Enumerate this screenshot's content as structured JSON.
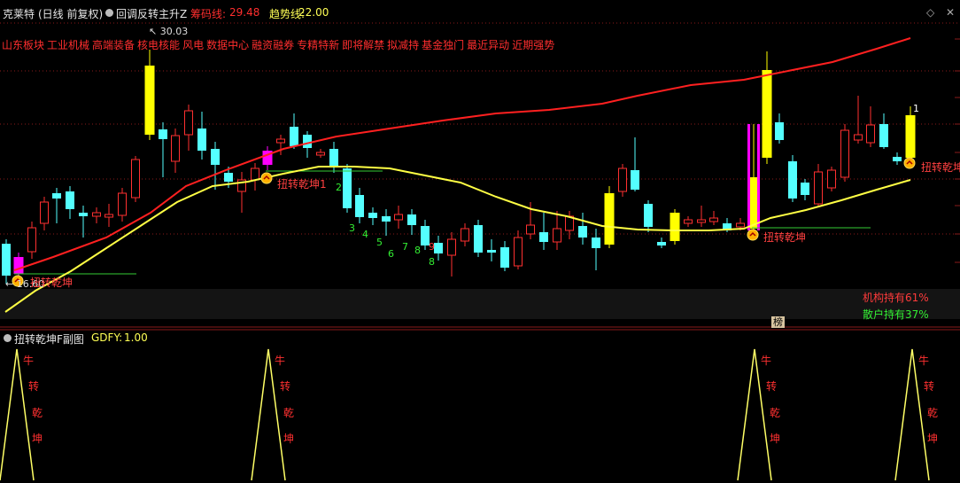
{
  "header": {
    "stock_name": "克莱特",
    "period": "(日线 前复权)",
    "indicator_name": "回调反转主升Z",
    "chip_label": "筹码线:",
    "chip_value": "29.48",
    "trend_label": "趋势线:",
    "trend_value": "22.00",
    "close_icon": "circle-close-icon",
    "collapse_icon": "diamond-icon"
  },
  "tags": [
    "山东板块",
    "工业机械",
    "高端装备",
    "核电核能",
    "风电",
    "数据中心",
    "融资融券",
    "专精特新",
    "即将解禁",
    "拟减持",
    "基金独门",
    "最近异动",
    "近期强势"
  ],
  "price_chart": {
    "high_label": "30.03",
    "low_label": "16.60",
    "signal_label": "扭转乾坤",
    "signal_label_1": "扭转乾坤1",
    "signal_label_cut": "扭转乾坤",
    "count_labels": [
      "1",
      "2",
      "3",
      "4",
      "5",
      "6",
      "7",
      "8",
      "9",
      "8",
      "9"
    ],
    "institution_label": "机构持有61%",
    "retail_label": "散户持有37%",
    "bang_label": "榜",
    "colors": {
      "up": "#ff3030",
      "down": "#54ffff",
      "yellow_candle": "#ffff00",
      "magenta_candle": "#ff00ff",
      "chip_line": "#ff2020",
      "trend_line": "#ffff44",
      "green_line": "#33cc33"
    }
  },
  "chart_data": {
    "type": "line",
    "title": "回调反转主升Z",
    "series": [
      {
        "name": "筹码线",
        "last_value": 29.48
      },
      {
        "name": "趋势线",
        "last_value": 22.0
      }
    ],
    "annotations": [
      "30.03",
      "16.60"
    ]
  },
  "sub_chart": {
    "title": "扭转乾坤F副图",
    "gdfy_label": "GDFY:",
    "gdfy_value": "1.00",
    "signal_chars": [
      "牛",
      "转",
      "乾",
      "坤"
    ],
    "chart_data": {
      "type": "line",
      "series": [
        {
          "name": "GDFY",
          "peak_value": 1.0
        }
      ]
    }
  }
}
